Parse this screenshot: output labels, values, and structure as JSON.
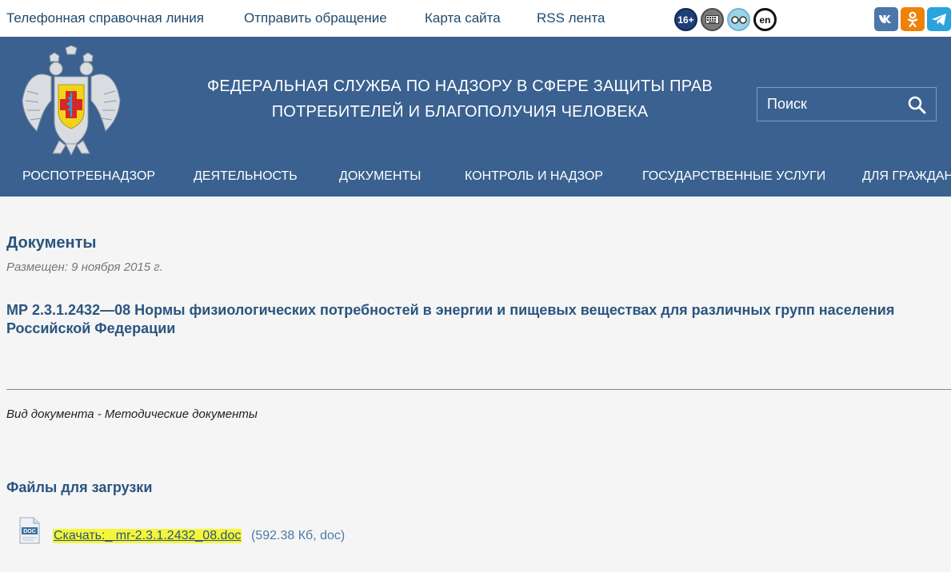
{
  "topbar": {
    "links": [
      {
        "label": "Телефонная справочная линия"
      },
      {
        "label": "Отправить обращение"
      },
      {
        "label": "Карта сайта"
      },
      {
        "label": "RSS лента"
      }
    ],
    "accessibility": {
      "age_rating": "16+",
      "language": "en"
    },
    "icons": [
      "age-rating-icon",
      "keyboard-icon",
      "low-vision-icon",
      "language-en-icon",
      "vk-icon",
      "odnoklassniki-icon",
      "telegram-icon"
    ]
  },
  "header": {
    "title_line1": "ФЕДЕРАЛЬНАЯ СЛУЖБА ПО НАДЗОРУ В СФЕРЕ ЗАЩИТЫ ПРАВ",
    "title_line2": "ПОТРЕБИТЕЛЕЙ И БЛАГОПОЛУЧИЯ ЧЕЛОВЕКА",
    "search_placeholder": "Поиск",
    "nav": [
      {
        "label": "РОСПОТРЕБНАДЗОР"
      },
      {
        "label": "ДЕЯТЕЛЬНОСТЬ"
      },
      {
        "label": "ДОКУМЕНТЫ"
      },
      {
        "label": "КОНТРОЛЬ И НАДЗОР"
      },
      {
        "label": "ГОСУДАРСТВЕННЫЕ УСЛУГИ"
      },
      {
        "label": "ДЛЯ ГРАЖДАН"
      }
    ]
  },
  "content": {
    "section_title": "Документы",
    "posted": "Размещен: 9 ноября 2015 г.",
    "doc_title": "МР 2.3.1.2432—08 Нормы физиологических потребностей в энергии и пищевых веществах для различных групп населения Российской Федерации",
    "doc_type": "Вид документа - Методические документы",
    "files_title": "Файлы для загрузки",
    "file": {
      "link": "Скачать:_ mr-2.3.1.2432_08.doc",
      "meta": "(592.38 Кб, doc)",
      "icon_label": "DOC"
    }
  },
  "colors": {
    "header_bg": "#3a6190",
    "page_bg": "#f5f5f5",
    "heading": "#2a5580",
    "highlight": "#f5f53a"
  }
}
